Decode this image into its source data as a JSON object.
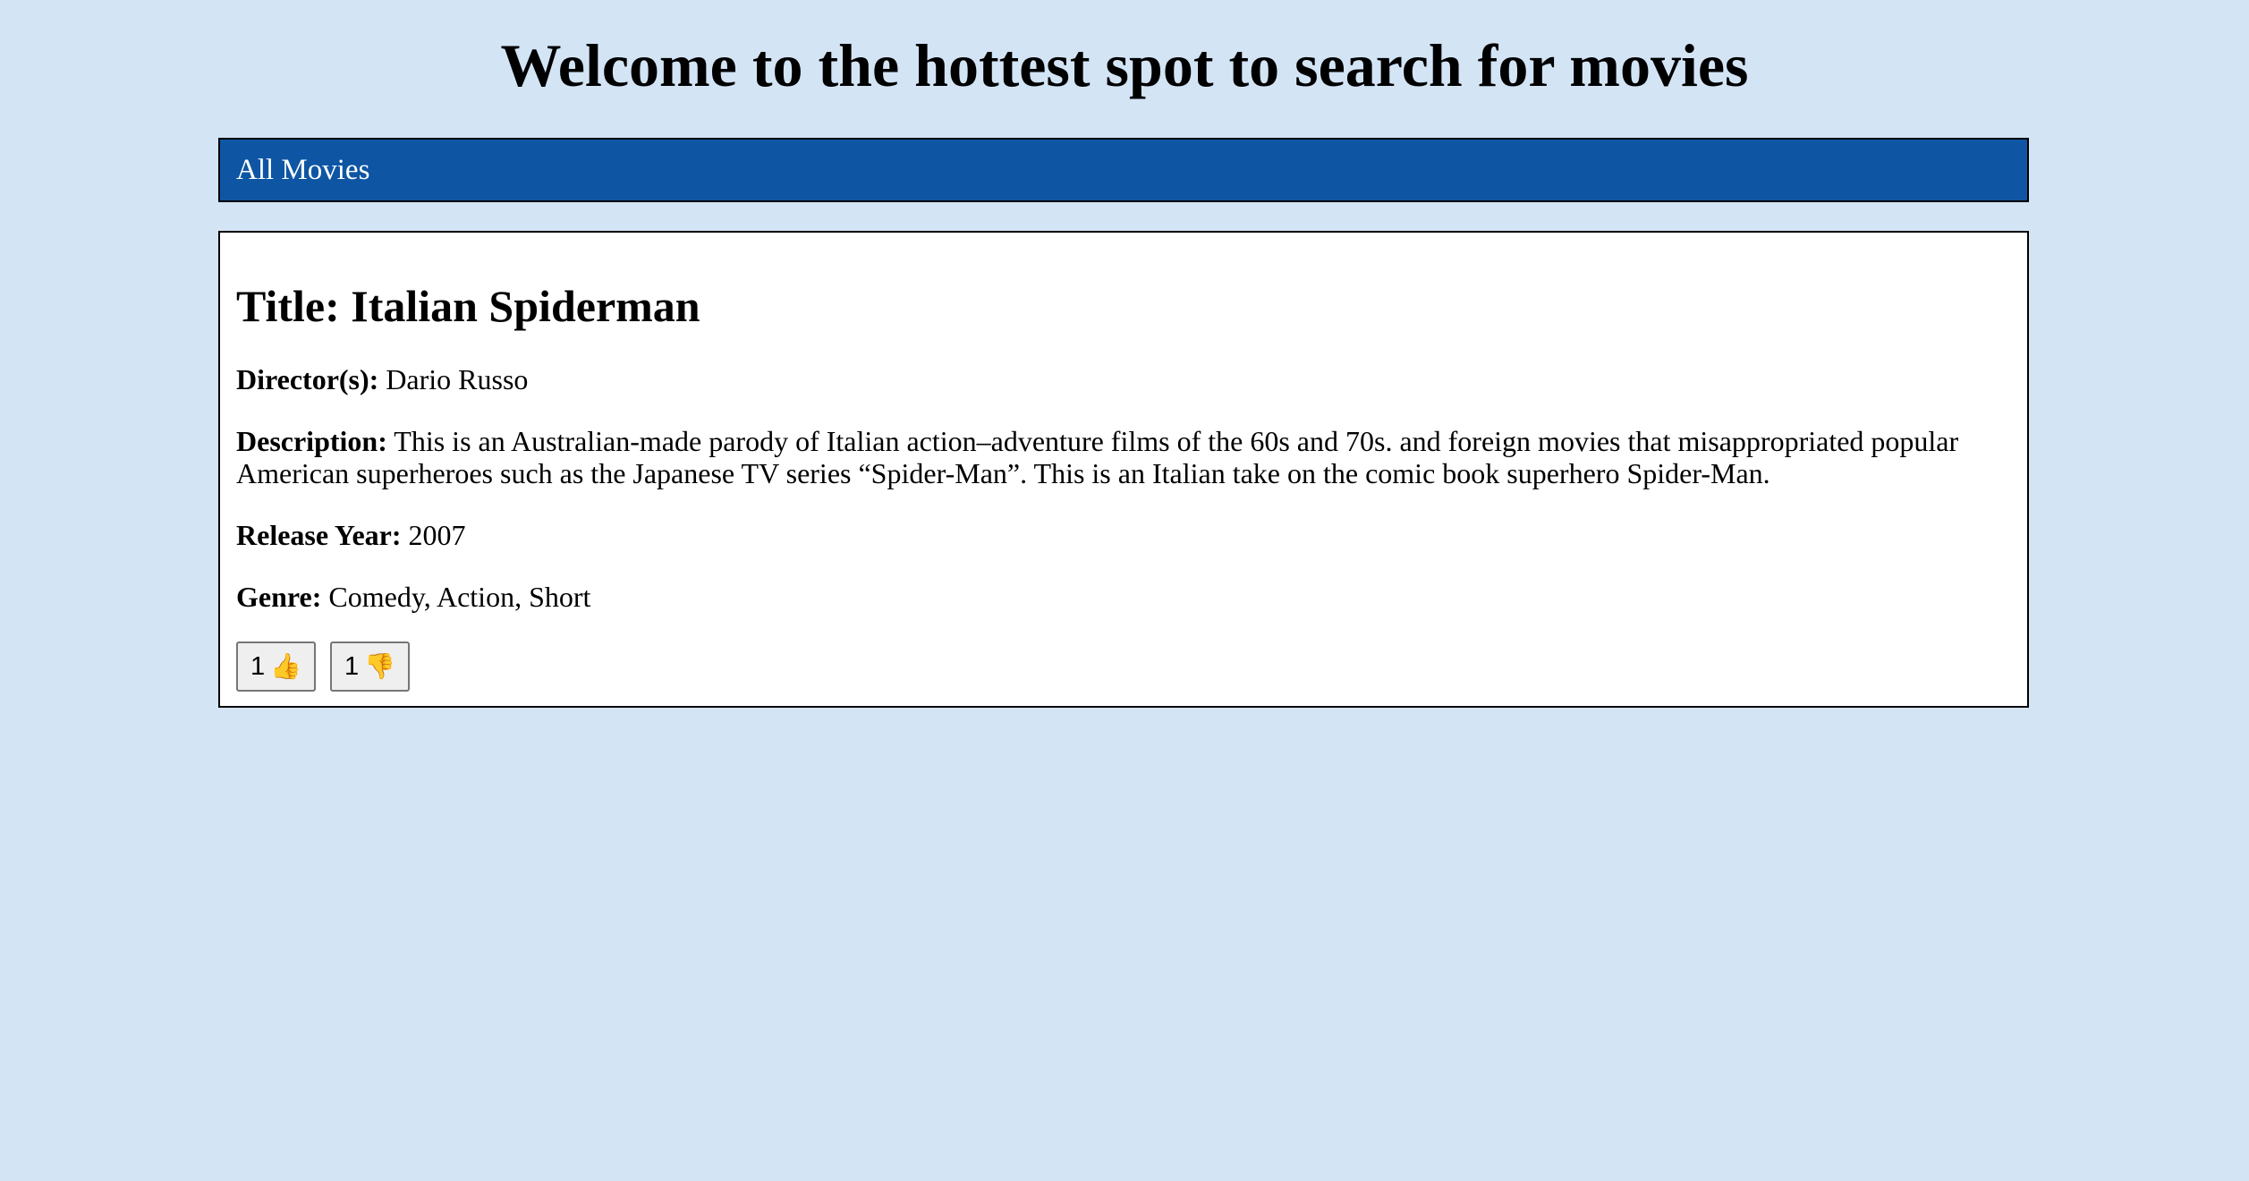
{
  "header": {
    "title": "Welcome to the hottest spot to search for movies"
  },
  "nav": {
    "all_movies_label": "All Movies"
  },
  "movie": {
    "title_label": "Title:",
    "title": "Italian Spiderman",
    "director_label": "Director(s):",
    "director": "Dario Russo",
    "description_label": "Description:",
    "description": "This is an Australian-made parody of Italian action–adventure films of the 60s and 70s. and foreign movies that misappropriated popular American superheroes such as the Japanese TV series “Spider-Man”. This is an Italian take on the comic book superhero Spider-Man.",
    "release_year_label": "Release Year:",
    "release_year": "2007",
    "genre_label": "Genre:",
    "genre": "Comedy, Action, Short",
    "likes": {
      "count": "1",
      "icon": "thumbs-up-icon",
      "glyph": "👍"
    },
    "dislikes": {
      "count": "1",
      "icon": "thumbs-down-icon",
      "glyph": "👎"
    }
  },
  "colors": {
    "page_background": "#d3e4f5",
    "nav_background": "#0e56a4",
    "card_background": "#ffffff"
  }
}
